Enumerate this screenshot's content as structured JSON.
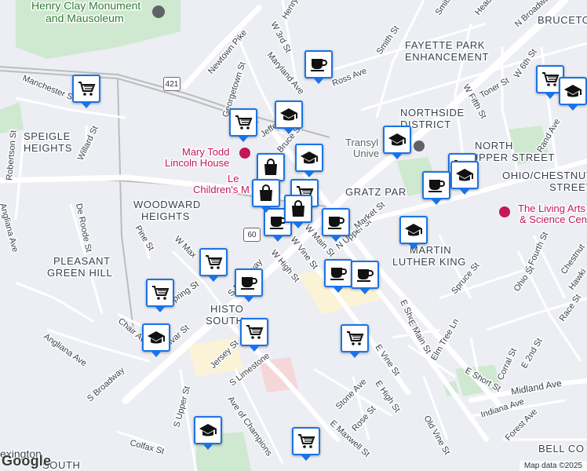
{
  "map": {
    "areas": {
      "henry_clay": "Henry Clay Monument and Mausoleum",
      "henry_clay_l1": "Henry Clay Monument",
      "henry_clay_l2": "and Mausoleum",
      "fayette_l1": "FAYETTE PARK",
      "fayette_l2": "ENHANCEMENT",
      "northside_l1": "NORTHSIDE",
      "northside_l2": "DISTRICT",
      "north_upper_l1": "NORTH",
      "north_upper_l2": "UPPER STREET",
      "ohio_l1": "OHIO/CHESTNUT",
      "ohio_l2": "STREET",
      "spiegle_l1": "SPEIGLE",
      "spiegle_l2": "HEIGHTS",
      "woodward_l1": "WOODWARD",
      "woodward_l2": "HEIGHTS",
      "pleasant_l1": "PLEASANT",
      "pleasant_l2": "GREEN HILL",
      "gratz": "GRATZ PAR",
      "mlk_l1": "MARTIN",
      "mlk_l2": "LUTHER KING",
      "historic_l1": "HISTO",
      "historic_l2": "SOUTH",
      "bell": "BELL CO",
      "bruceto": "BRUCETO",
      "lexington": "exington",
      "south": "SOUTH"
    },
    "pois": {
      "mary_todd_l1": "Mary Todd",
      "mary_todd_l2": "Lincoln House",
      "transylvania": "Transyl",
      "transylvania2": "Unive",
      "living_arts_l1": "The Living Arts",
      "living_arts_l2": "& Science Cen",
      "lex_children_l1": "Le",
      "lex_children_l2": "Children's M"
    },
    "roads": {
      "henry": "Henry St",
      "w3rd": "W 3rd St",
      "smith_st": "Smith St",
      "headley": "Headle",
      "n_broadway": "N Broadwa",
      "maryland": "Maryland Ave",
      "newtown": "Newtown Pike",
      "georgetown": "Georgetown St",
      "ross": "Ross Ave",
      "smith": "Smith St",
      "w6th": "W 6th St",
      "toner": "Toner St",
      "w_fifth": "W Fifth St",
      "manchester": "Manchester St",
      "jefferson": "Jeffer",
      "bruce": "Bruce St",
      "willard": "Willard St",
      "robertson": "Robertson St",
      "rand": "Rand Ave",
      "de_roode": "De Roode St",
      "anglian": "Angliana Ave",
      "pine": "Pine St",
      "w_max": "W Max",
      "s_broadway_upper": "S Broadway",
      "s_broadway": "S Broadway",
      "w_high": "W High St",
      "w_vine": "W Vine St",
      "w_main": "W Main St",
      "n_upper": "N Upper St",
      "market": "Market St",
      "spring": "pring St",
      "chair": "Chair Ave",
      "angliana_low": "Angliana Ave",
      "bolivar": "olivar St",
      "jersey": "Jersey St",
      "s_limestone": "S Limestone",
      "s_upper": "S Upper St",
      "ave_champions": "Ave of Champions",
      "colfax": "Colfax St",
      "e_short": "E Short St",
      "e_main": "E Main St",
      "e_vine": "E Vine St",
      "e_high": "E High St",
      "elm_tree": "Elm Tree Ln",
      "stone": "Stone Ave",
      "rose": "Rose St",
      "e_maxwell": "E Maxwell St",
      "old_vine": "Old Vine St",
      "spruce": "Spruce St",
      "e_fourth": "E Fourth St",
      "ohio": "Ohio St",
      "chestnut": "Chestnut",
      "hawk": "Hawki",
      "race": "Race St",
      "e2nd": "E 2nd St",
      "corral": "Corral St",
      "e_short2": "E Short St",
      "midland": "Midland Ave",
      "indiana": "Indiana Ave",
      "forest": "Forest Ave"
    },
    "shields": {
      "us421": "421",
      "us60": "60"
    },
    "markers": [
      {
        "type": "cart-icon"
      },
      {
        "type": "cart-icon"
      },
      {
        "type": "cart-icon"
      },
      {
        "type": "cart-icon"
      },
      {
        "type": "cart-icon"
      },
      {
        "type": "cart-icon"
      },
      {
        "type": "cart-icon"
      },
      {
        "type": "cart-icon"
      },
      {
        "type": "cart-icon"
      },
      {
        "type": "cart-icon"
      },
      {
        "type": "coffee-icon"
      },
      {
        "type": "coffee-icon"
      },
      {
        "type": "coffee-icon"
      },
      {
        "type": "coffee-icon"
      },
      {
        "type": "coffee-icon"
      },
      {
        "type": "coffee-icon"
      },
      {
        "type": "coffee-icon"
      },
      {
        "type": "school-icon"
      },
      {
        "type": "school-icon"
      },
      {
        "type": "school-icon"
      },
      {
        "type": "school-icon"
      },
      {
        "type": "school-icon"
      },
      {
        "type": "school-icon"
      },
      {
        "type": "school-icon"
      },
      {
        "type": "school-icon"
      },
      {
        "type": "shopping-bag-icon"
      },
      {
        "type": "shopping-bag-icon"
      },
      {
        "type": "shopping-bag-icon"
      }
    ],
    "colors": {
      "background": "#eceef3",
      "park": "#c8e6c9",
      "road": "#ffffff",
      "rail": "#bcbcbc",
      "marker_border": "#1a73e8",
      "poi_pink": "#c2185b"
    },
    "logo": "Google",
    "attribution": "Map data ©2025"
  }
}
